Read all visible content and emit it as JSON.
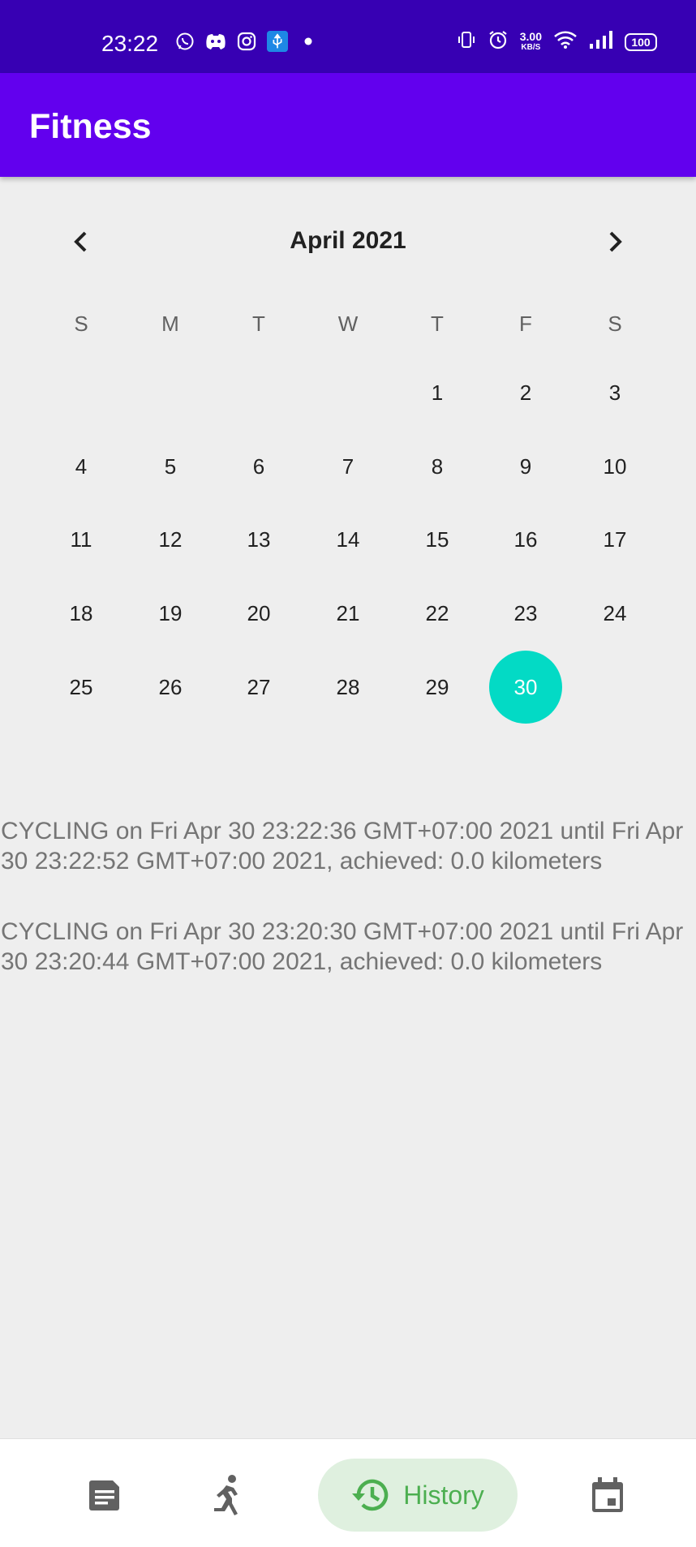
{
  "status_bar": {
    "time": "23:22",
    "net_speed_value": "3.00",
    "net_speed_unit": "KB/S",
    "battery": "100"
  },
  "app_bar": {
    "title": "Fitness"
  },
  "calendar": {
    "month_label": "April 2021",
    "weekdays": [
      "S",
      "M",
      "T",
      "W",
      "T",
      "F",
      "S"
    ],
    "days": [
      "1",
      "2",
      "3",
      "4",
      "5",
      "6",
      "7",
      "8",
      "9",
      "10",
      "11",
      "12",
      "13",
      "14",
      "15",
      "16",
      "17",
      "18",
      "19",
      "20",
      "21",
      "22",
      "23",
      "24",
      "25",
      "26",
      "27",
      "28",
      "29",
      "30"
    ],
    "selected_day": "30",
    "accent_color": "#03dac5"
  },
  "history": {
    "entries": [
      "CYCLING on Fri Apr 30 23:22:36 GMT+07:00 2021 until Fri Apr 30 23:22:52 GMT+07:00 2021, achieved: 0.0 kilometers",
      "CYCLING on Fri Apr 30 23:20:30 GMT+07:00 2021 until Fri Apr 30 23:20:44 GMT+07:00 2021, achieved: 0.0 kilometers"
    ]
  },
  "bottom_nav": {
    "items": [
      {
        "icon": "document-icon"
      },
      {
        "icon": "running-icon"
      },
      {
        "icon": "history-icon",
        "label": "History",
        "active": true
      },
      {
        "icon": "calendar-icon"
      }
    ]
  },
  "colors": {
    "status_bar": "#3700b3",
    "app_bar": "#6200ee",
    "active_nav": "#4caf50"
  }
}
